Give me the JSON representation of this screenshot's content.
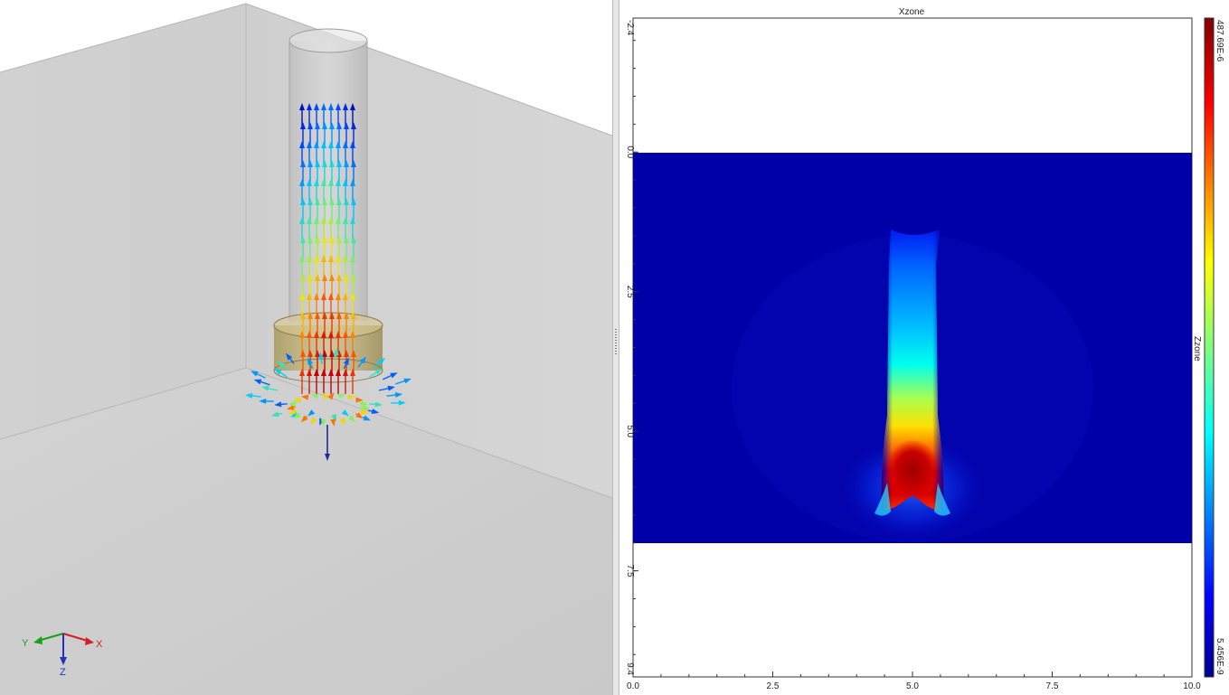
{
  "scene3d": {
    "triad": {
      "x_label": "X",
      "y_label": "Y",
      "z_label": "Z"
    },
    "colors": {
      "triad_x": "#d42020",
      "triad_y": "#18a018",
      "triad_z": "#2030c0"
    }
  },
  "plot2d": {
    "title": "Xzone",
    "side_label": "Zzone",
    "colorbar": {
      "max_label": "487.69E-6",
      "min_label": "5.456E-9"
    },
    "x_ticks": [
      "0.0",
      "2.5",
      "5.0",
      "7.5",
      "10.0"
    ],
    "y_ticks": [
      "-2.4",
      "0.0",
      "2.5",
      "5.0",
      "7.5",
      "9.4"
    ]
  },
  "chart_data": {
    "type": "heatmap",
    "title": "Xzone",
    "xlabel": "",
    "ylabel": "",
    "colorbar_label": "Zzone",
    "xlim": [
      0.0,
      10.0
    ],
    "ylim": [
      -2.4,
      9.4
    ],
    "y_inverted": true,
    "data_extent_y": [
      0.0,
      7.0
    ],
    "value_range": [
      5.456e-09,
      0.00048769
    ],
    "colormap": "jet",
    "peak_region": {
      "x": [
        4.6,
        5.5
      ],
      "y": [
        5.3,
        6.2
      ]
    },
    "plume_x_range": [
      4.5,
      5.6
    ],
    "plume_y_range": [
      1.4,
      6.5
    ]
  }
}
